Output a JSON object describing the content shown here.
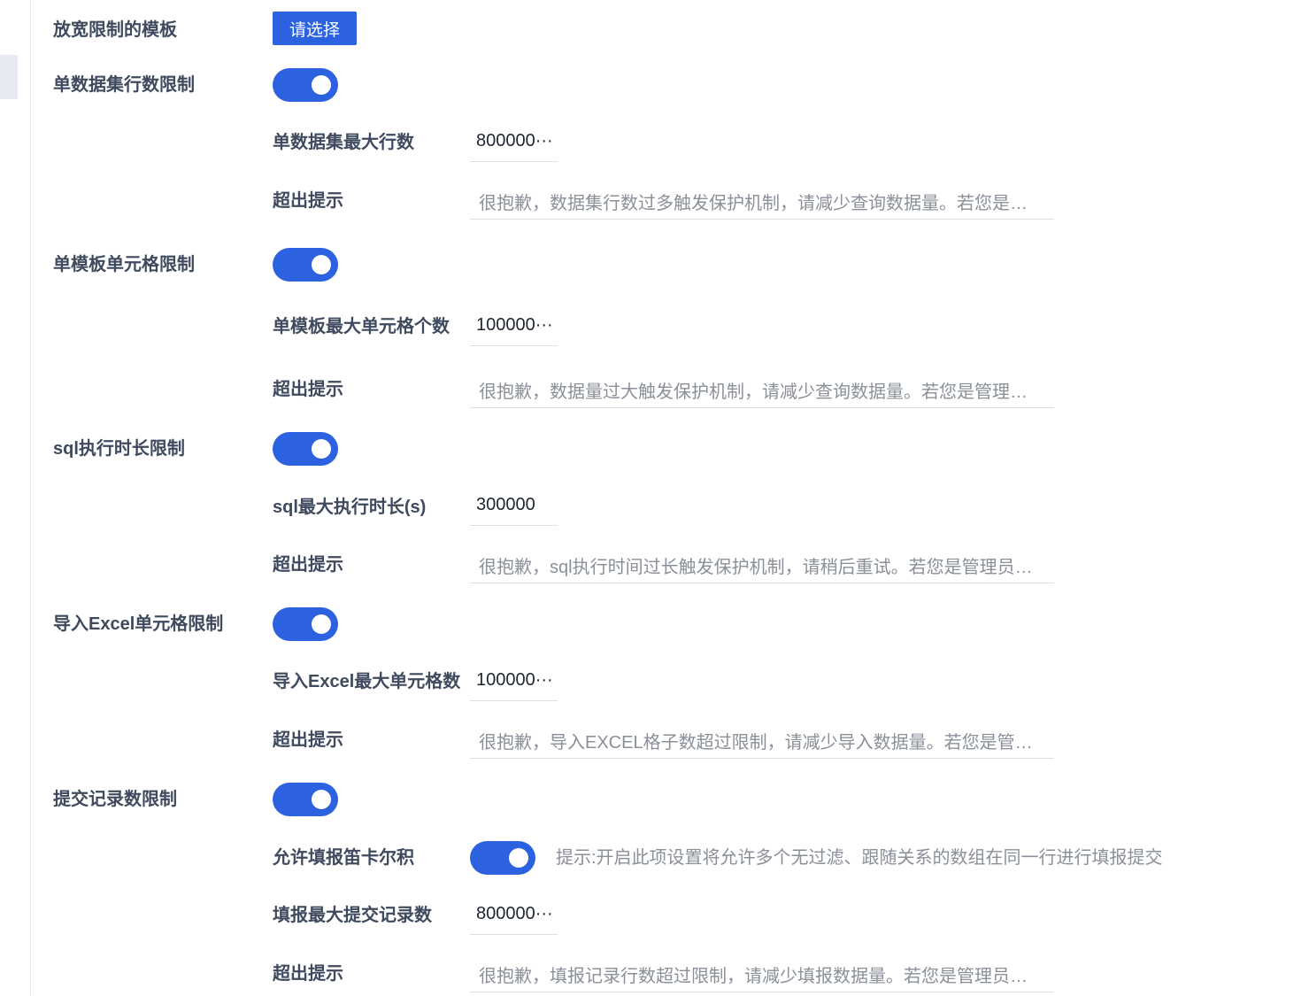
{
  "template": {
    "label": "放宽限制的模板",
    "button": "请选择"
  },
  "dataset_limit": {
    "label": "单数据集行数限制",
    "enabled": true,
    "max_label": "单数据集最大行数",
    "max_value": "800000···",
    "tip_label": "超出提示",
    "tip_value": "很抱歉，数据集行数过多触发保护机制，请减少查询数据量。若您是管理员，可以在管理系统修改限制"
  },
  "cell_limit": {
    "label": "单模板单元格限制",
    "enabled": true,
    "max_label": "单模板最大单元格个数",
    "max_value": "100000···",
    "tip_label": "超出提示",
    "tip_value": "很抱歉，数据量过大触发保护机制，请减少查询数据量。若您是管理员，可以在管理系统修改限制"
  },
  "sql_limit": {
    "label": "sql执行时长限制",
    "enabled": true,
    "max_label": "sql最大执行时长(s)",
    "max_value": "300000",
    "tip_label": "超出提示",
    "tip_value": "很抱歉，sql执行时间过长触发保护机制，请稍后重试。若您是管理员，可以在管理系统修改限制"
  },
  "excel_limit": {
    "label": "导入Excel单元格限制",
    "enabled": true,
    "max_label": "导入Excel最大单元格数",
    "max_value": "100000···",
    "tip_label": "超出提示",
    "tip_value": "很抱歉，导入EXCEL格子数超过限制，请减少导入数据量。若您是管理员，可以在管理系统修改限制"
  },
  "submit_limit": {
    "label": "提交记录数限制",
    "enabled": true,
    "cartesian_label": "允许填报笛卡尔积",
    "cartesian_enabled": true,
    "cartesian_hint": "提示:开启此项设置将允许多个无过滤、跟随关系的数组在同一行进行填报提交",
    "max_label": "填报最大提交记录数",
    "max_value": "800000···",
    "tip_label": "超出提示",
    "tip_value": "很抱歉，填报记录行数超过限制，请减少填报数据量。若您是管理员，可以在管理系统修改限制"
  },
  "colors": {
    "primary": "#2c62e0",
    "label": "#3f4a5e",
    "placeholder": "#8a8f99"
  }
}
